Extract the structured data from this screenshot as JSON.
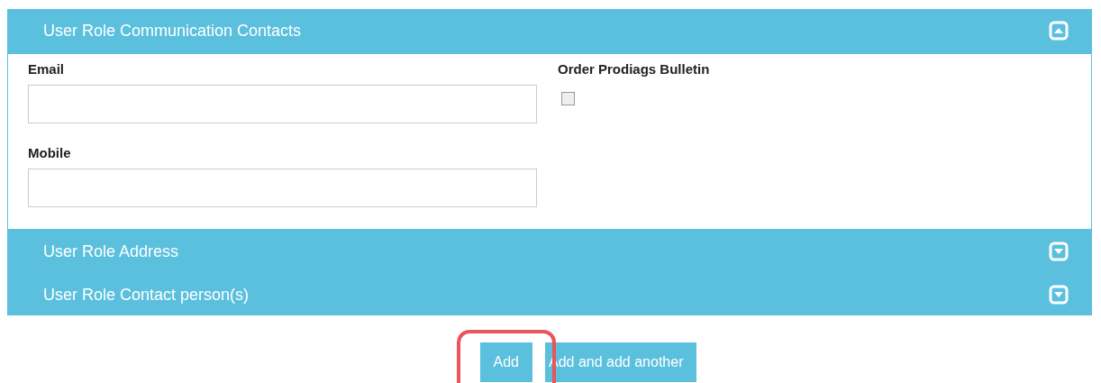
{
  "sections": [
    {
      "title": "User Role Communication Contacts",
      "expanded": true,
      "fields": [
        {
          "kind": "text",
          "label": "Email"
        },
        {
          "kind": "text",
          "label": "Mobile"
        }
      ],
      "side_fields": [
        {
          "kind": "checkbox",
          "label": "Order Prodiags Bulletin",
          "checked": false
        }
      ]
    },
    {
      "title": "User Role Address",
      "expanded": false
    },
    {
      "title": "User Role Contact person(s)",
      "expanded": false
    }
  ],
  "buttons": [
    {
      "label": "Add",
      "highlighted": true
    },
    {
      "label": "Add and add another",
      "highlighted": false
    }
  ]
}
